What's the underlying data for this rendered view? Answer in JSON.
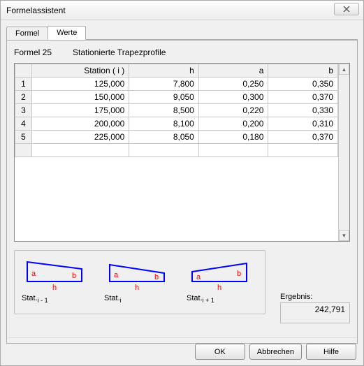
{
  "window": {
    "title": "Formelassistent"
  },
  "tabs": {
    "formel": "Formel",
    "werte": "Werte",
    "active": "werte"
  },
  "subtitle": {
    "formula": "Formel 25",
    "desc": "Stationierte Trapezprofile"
  },
  "grid": {
    "headers": {
      "station": "Station ( i )",
      "h": "h",
      "a": "a",
      "b": "b"
    },
    "rows": [
      {
        "n": "1",
        "station": "125,000",
        "h": "7,800",
        "a": "0,250",
        "b": "0,350"
      },
      {
        "n": "2",
        "station": "150,000",
        "h": "9,050",
        "a": "0,300",
        "b": "0,370"
      },
      {
        "n": "3",
        "station": "175,000",
        "h": "8,500",
        "a": "0,220",
        "b": "0,330"
      },
      {
        "n": "4",
        "station": "200,000",
        "h": "8,100",
        "a": "0,200",
        "b": "0,310"
      },
      {
        "n": "5",
        "station": "225,000",
        "h": "8,050",
        "a": "0,180",
        "b": "0,370"
      }
    ]
  },
  "diagrams": {
    "labels": {
      "a": "a",
      "b": "b",
      "h": "h",
      "stat": "Stat."
    },
    "subs": {
      "im1": "i - 1",
      "i": "i",
      "ip1": "i + 1"
    }
  },
  "result": {
    "label": "Ergebnis:",
    "value": "242,791"
  },
  "buttons": {
    "ok": "OK",
    "cancel": "Abbrechen",
    "help": "Hilfe"
  },
  "chart_data": {
    "type": "table",
    "title": "Stationierte Trapezprofile (Formel 25)",
    "columns": [
      "Station (i)",
      "h",
      "a",
      "b"
    ],
    "rows": [
      [
        125.0,
        7.8,
        0.25,
        0.35
      ],
      [
        150.0,
        9.05,
        0.3,
        0.37
      ],
      [
        175.0,
        8.5,
        0.22,
        0.33
      ],
      [
        200.0,
        8.1,
        0.2,
        0.31
      ],
      [
        225.0,
        8.05,
        0.18,
        0.37
      ]
    ],
    "result": 242.791
  }
}
